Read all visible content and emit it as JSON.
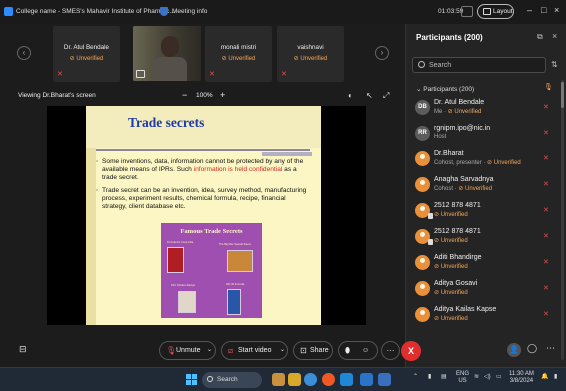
{
  "window": {
    "title": "College name - SMES's Mahavir Institute of Pharmac...",
    "meeting_info": "Meeting info",
    "timer": "01:03:59",
    "layout_label": "Layout"
  },
  "strip": {
    "tiles": [
      {
        "name": "Dr. Atul Bendale",
        "status": "Unverified"
      },
      {
        "name": "monali mistri",
        "status": "Unverified"
      },
      {
        "name": "vaishnavi",
        "status": "Unverified"
      }
    ]
  },
  "share": {
    "viewing": "Viewing Dr.Bharat's screen",
    "zoom": "100%"
  },
  "slide": {
    "title": "Trade secrets",
    "bullet1_pre": "Some inventions, data, information cannot be protected by any of the available means of IPRs. Such ",
    "bullet1_red": "information is held confidential",
    "bullet1_post": " as a trade secret.",
    "bullet2": "Trade secret can be an invention, idea, survey method, manufacturing process, experiment results, chemical formula, recipe, financial strategy, client database etc.",
    "image_title": "Famous Trade Secrets",
    "image_captions": [
      "Formula for Coca-Cola",
      "The Big Mac Special Sauce",
      "KFC Chicken Recipe",
      "WD-40 Formula"
    ]
  },
  "participants": {
    "title": "Participants (200)",
    "search_placeholder": "Search",
    "section_label": "Participants (200)",
    "list": [
      {
        "initials": "DB",
        "avatar": "gray",
        "name": "Dr. Atul Bendale",
        "sub_pre": "Me · ",
        "sub_unv": "Unverified",
        "phone": false
      },
      {
        "initials": "RR",
        "avatar": "gray",
        "name": "rgnipm.ipo@nic.in",
        "sub_pre": "Host",
        "sub_unv": "",
        "phone": false
      },
      {
        "initials": "",
        "avatar": "orange",
        "name": "Dr.Bharat",
        "sub_pre": "Cohost, presenter · ",
        "sub_unv": "Unverified",
        "phone": false
      },
      {
        "initials": "",
        "avatar": "orange",
        "name": "Anagha Sarvadnya",
        "sub_pre": "Cohost · ",
        "sub_unv": "Unverified",
        "phone": false
      },
      {
        "initials": "",
        "avatar": "orange",
        "name": "2512 878 4871",
        "sub_pre": "",
        "sub_unv": "Unverified",
        "phone": true
      },
      {
        "initials": "",
        "avatar": "orange",
        "name": "2512 878 4871",
        "sub_pre": "",
        "sub_unv": "Unverified",
        "phone": true
      },
      {
        "initials": "",
        "avatar": "orange",
        "name": "Aditi Bhandirge",
        "sub_pre": "",
        "sub_unv": "Unverified",
        "phone": false
      },
      {
        "initials": "",
        "avatar": "orange",
        "name": "Aditya Gosavi",
        "sub_pre": "",
        "sub_unv": "Unverified",
        "phone": false
      },
      {
        "initials": "",
        "avatar": "orange",
        "name": "Aditya Kailas Kapse",
        "sub_pre": "",
        "sub_unv": "Unverified",
        "phone": false
      }
    ]
  },
  "controls": {
    "unmute": "Unmute",
    "start_video": "Start video",
    "share": "Share",
    "more": "···",
    "end": "X"
  },
  "taskbar": {
    "search": "Search",
    "lang_top": "ENG",
    "lang_bottom": "US",
    "time": "11:30 AM",
    "date": "3/8/2024"
  },
  "colors": {
    "accent": "#2d8cff",
    "unverified": "#f2a65a",
    "muted": "#e05252",
    "end_call": "#e02e2e",
    "slide_title": "#1f3aa8"
  }
}
